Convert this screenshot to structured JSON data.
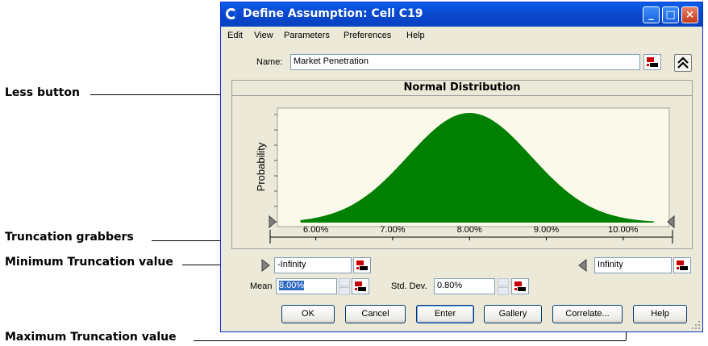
{
  "callouts": {
    "less_button": "Less button",
    "truncation_grabbers": "Truncation grabbers",
    "minimum_truncation": "Minimum Truncation value",
    "maximum_truncation": "Maximum Truncation value"
  },
  "window": {
    "title": "Define Assumption: Cell C19",
    "controls": {
      "minimize": "_",
      "maximize": "□",
      "close": "×"
    }
  },
  "menu": [
    "Edit",
    "View",
    "Parameters",
    "Preferences",
    "Help"
  ],
  "name_field": {
    "label": "Name:",
    "value": "Market Penetration"
  },
  "chart_data": {
    "type": "area",
    "title": "Normal Distribution",
    "ylabel": "Probability",
    "x_ticks": [
      "6.00%",
      "7.00%",
      "8.00%",
      "9.00%",
      "10.00%"
    ],
    "x": [
      5.8,
      5.9,
      6.0,
      6.1,
      6.2,
      6.3,
      6.4,
      6.5,
      6.6,
      6.7,
      6.8,
      6.9,
      7.0,
      7.1,
      7.2,
      7.3,
      7.4,
      7.5,
      7.6,
      7.7,
      7.8,
      7.9,
      8.0,
      8.1,
      8.2,
      8.3,
      8.4,
      8.5,
      8.6,
      8.7,
      8.8,
      8.9,
      9.0,
      9.1,
      9.2,
      9.3,
      9.4,
      9.5,
      9.6,
      9.7,
      9.8,
      9.9,
      10.0,
      10.1,
      10.2,
      10.3,
      10.4
    ],
    "mean": 8.0,
    "std_dev": 0.8,
    "fill_color": "#008000",
    "plot_background": "#fbf9e9"
  },
  "truncation": {
    "min_value": "-Infinity",
    "max_value": "Infinity"
  },
  "parameters": {
    "mean_label": "Mean",
    "mean_value": "8.00%",
    "std_label": "Std. Dev.",
    "std_value": "0.80%"
  },
  "buttons": {
    "ok": "OK",
    "cancel": "Cancel",
    "enter": "Enter",
    "gallery": "Gallery",
    "correlate": "Correlate...",
    "help": "Help"
  },
  "colors": {
    "titlebar": "#0a5fe8",
    "dialog_bg": "#ece9d8",
    "series": "#008000"
  }
}
